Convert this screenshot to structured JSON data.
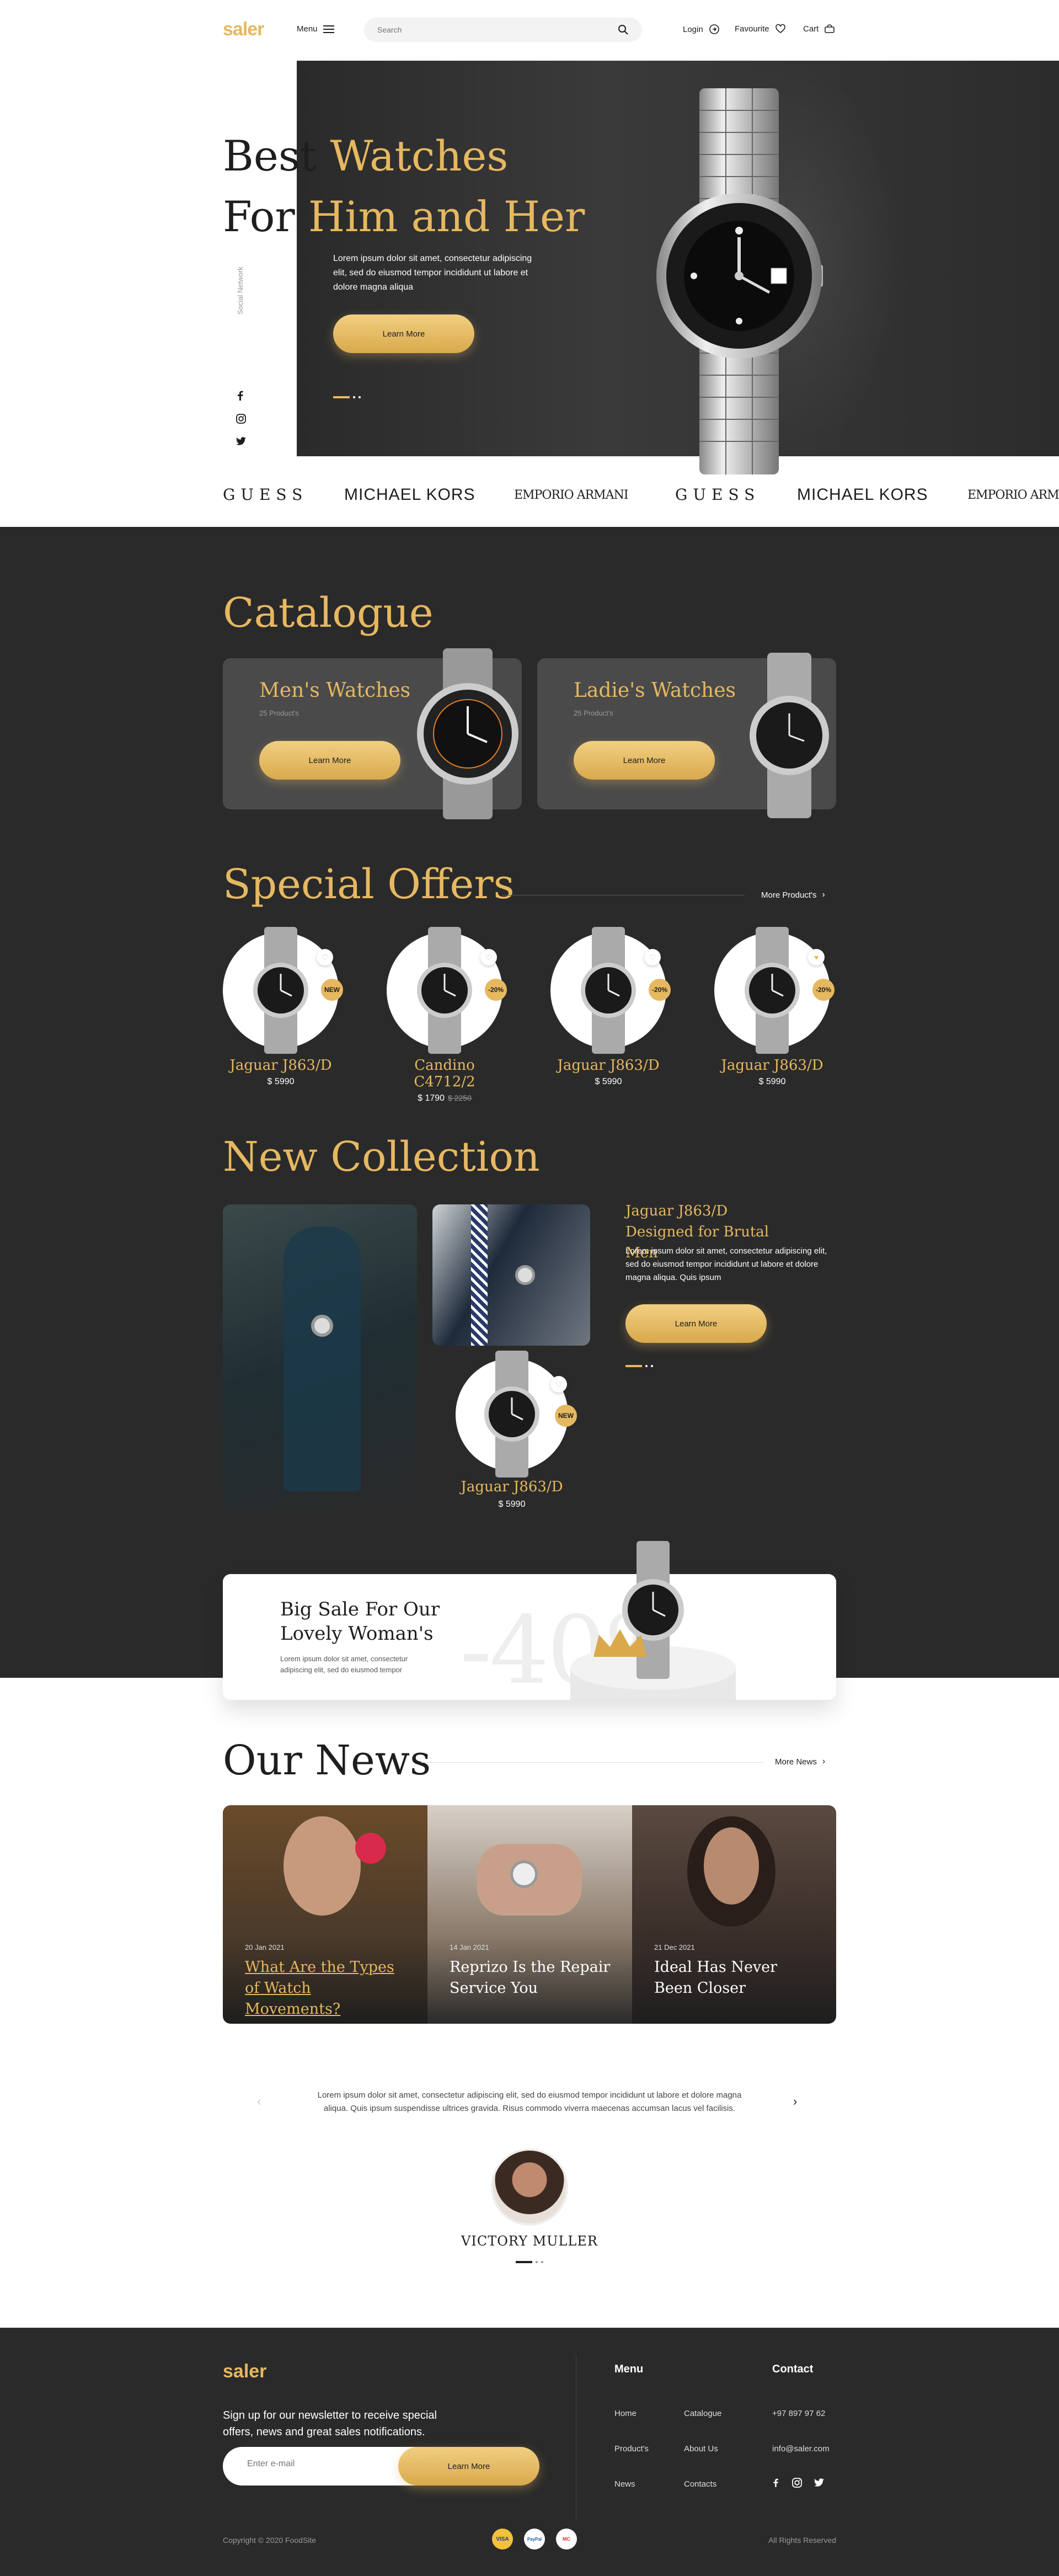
{
  "header": {
    "logo": "saler",
    "menu_label": "Menu",
    "search_placeholder": "Search",
    "login_label": "Login",
    "favourite_label": "Favourite",
    "cart_label": "Cart"
  },
  "hero": {
    "title_line1_a": "Best ",
    "title_line1_b": "Watches",
    "title_line2_a": "For ",
    "title_line2_b": "Him and Her",
    "text": "Lorem ipsum dolor sit amet, consectetur adipiscing elit, sed do eiusmod tempor incididunt ut labore et dolore magna aliqua",
    "button": "Learn More",
    "social_label": "Social Network"
  },
  "brands": [
    "GUESS",
    "MICHAEL KORS",
    "EMPORIO ARMANI",
    "GUESS",
    "MICHAEL KORS",
    "EMPORIO ARMANI"
  ],
  "catalogue": {
    "title": "Catalogue",
    "cards": [
      {
        "title": "Men's Watches",
        "count": "25 Product's",
        "button": "Learn More"
      },
      {
        "title": "Ladie's Watches",
        "count": "25 Product's",
        "button": "Learn More"
      }
    ]
  },
  "offers": {
    "title": "Special Offers",
    "more": "More Product's",
    "items": [
      {
        "name": "Jaguar J863/D",
        "price": "$ 5990",
        "old_price": "",
        "badge": "NEW"
      },
      {
        "name": "Candino C4712/2",
        "price": "$ 1790",
        "old_price": "$ 2250",
        "badge": "-20%"
      },
      {
        "name": "Jaguar J863/D",
        "price": "$ 5990",
        "old_price": "",
        "badge": "-20%"
      },
      {
        "name": "Jaguar J863/D",
        "price": "$ 5990",
        "old_price": "",
        "badge": "-20%"
      }
    ]
  },
  "collection": {
    "title": "New Collection",
    "heading": "Jaguar J863/D Designed for Brutal Men",
    "text": "Lorem ipsum dolor sit amet, consectetur adipiscing elit, sed do eiusmod tempor incididunt ut labore et dolore magna aliqua. Quis ipsum",
    "button": "Learn More",
    "product": {
      "name": "Jaguar J863/D",
      "price": "$ 5990",
      "badge": "NEW"
    }
  },
  "sale": {
    "title": "Big Sale For Our Lovely Woman's",
    "text": "Lorem ipsum dolor sit amet, consectetur adipiscing elit, sed do eiusmod tempor",
    "percent": "-40%"
  },
  "news": {
    "title": "Our News",
    "more": "More News",
    "items": [
      {
        "date": "20 Jan 2021",
        "title": "What Are the Types of Watch Movements?"
      },
      {
        "date": "14 Jan 2021",
        "title": "Reprizo Is the Repair Service You"
      },
      {
        "date": "21 Dec 2021",
        "title": "Ideal Has Never Been Closer"
      }
    ]
  },
  "testimonial": {
    "text": "Lorem ipsum dolor sit amet, consectetur adipiscing elit, sed do eiusmod tempor incididunt ut labore et dolore magna aliqua. Quis ipsum suspendisse ultrices gravida. Risus commodo viverra maecenas accumsan lacus vel facilisis.",
    "name": "VICTORY MULLER"
  },
  "footer": {
    "logo": "saler",
    "newsletter": "Sign up for our newsletter to receive special offers, news and great sales notifications.",
    "email_placeholder": "Enter e-mail",
    "button": "Learn More",
    "menu_title": "Menu",
    "menu": [
      "Home",
      "Catalogue",
      "Product's",
      "About Us",
      "News",
      "Contacts"
    ],
    "contact_title": "Contact",
    "phone": "+97 897 97 62",
    "email": "info@saler.com",
    "copyright": "Copyright © 2020 FoodSite",
    "rights": "All Rights Reserved",
    "payments": [
      "VISA",
      "PayPal",
      "MC"
    ]
  }
}
